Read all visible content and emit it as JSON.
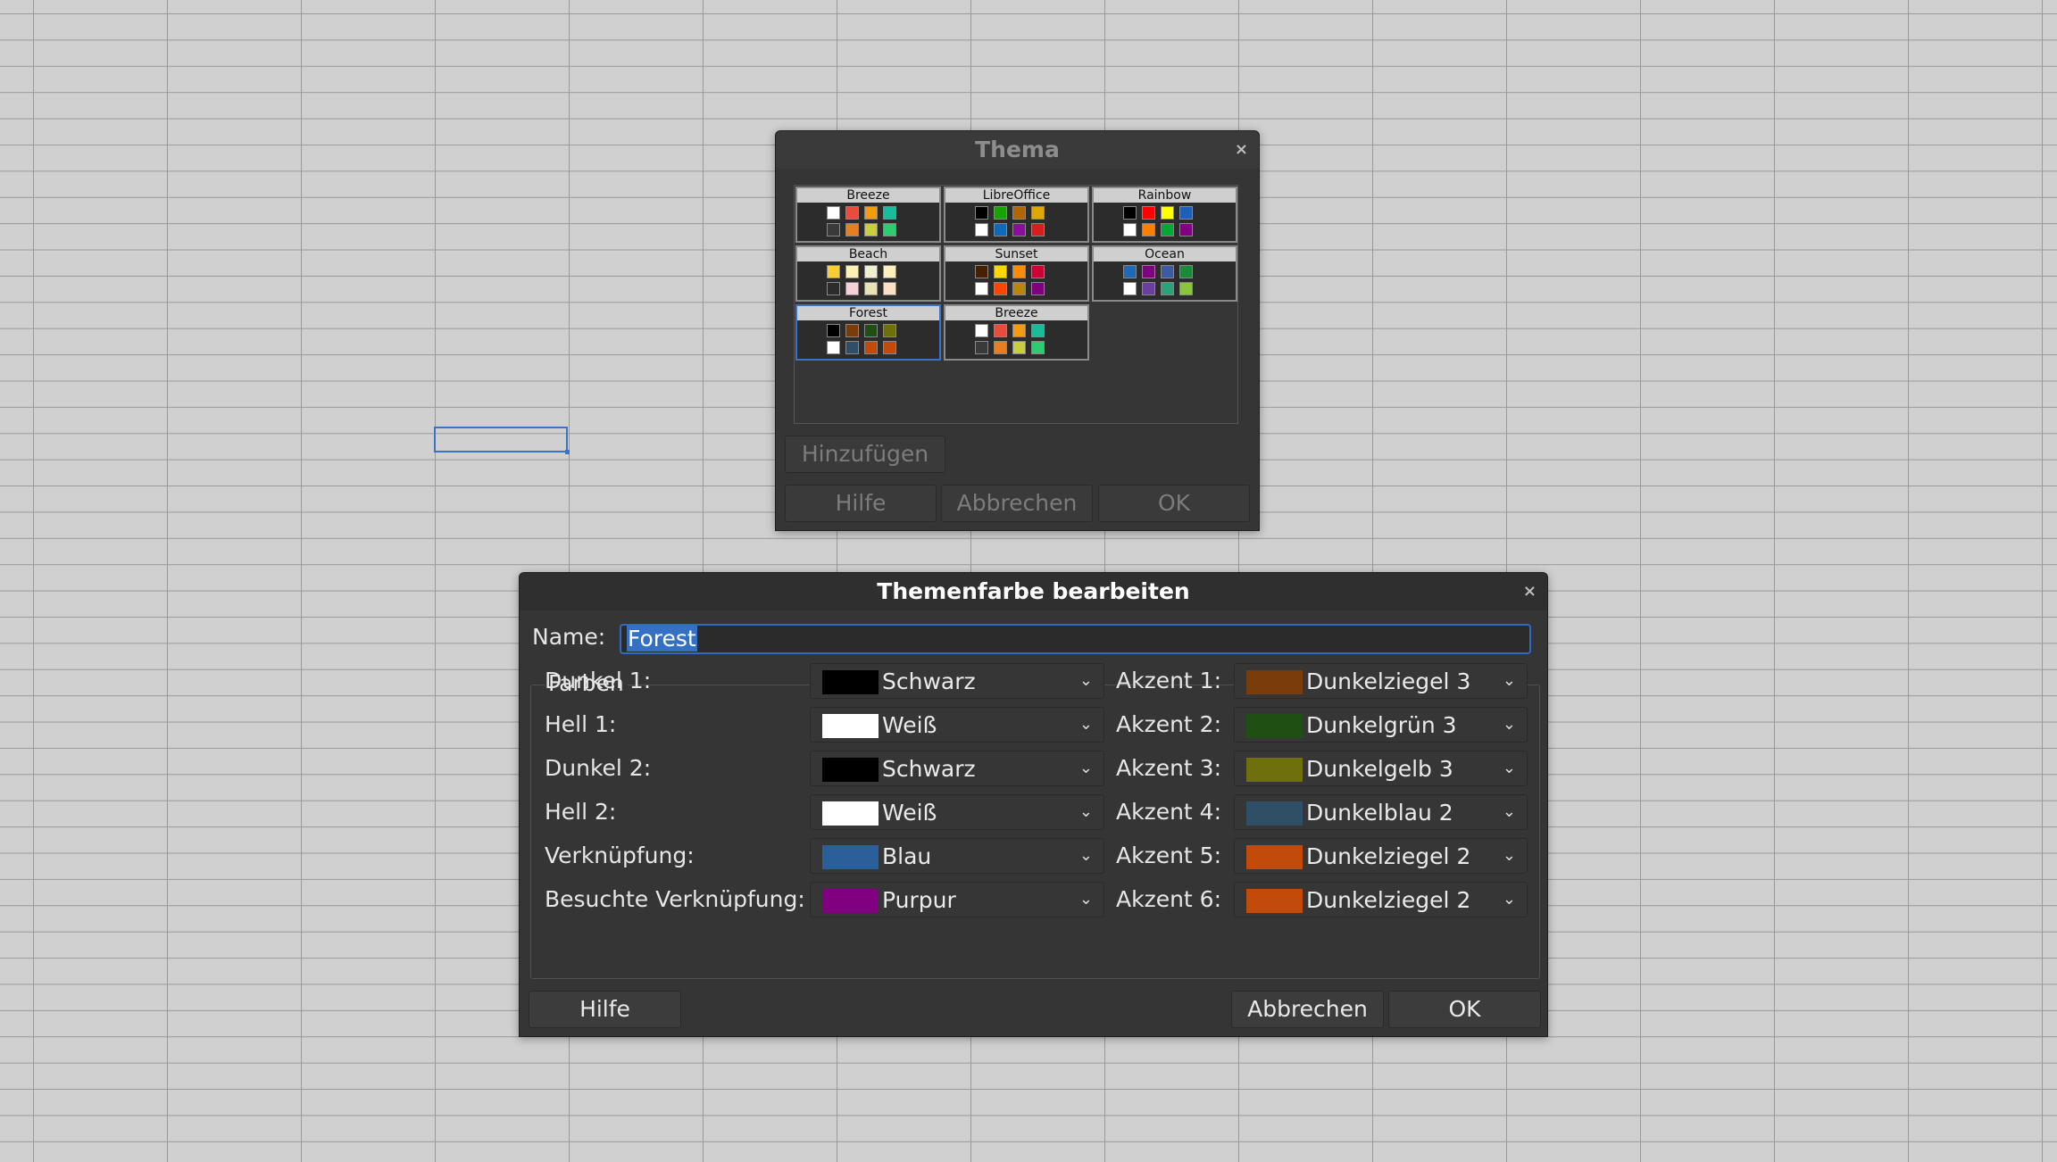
{
  "theme_dialog": {
    "title": "Thema",
    "close_icon": "close-icon",
    "themes": [
      {
        "name": "Breeze",
        "colors": [
          "#ffffff",
          "#3a3a3a",
          "#ffffff",
          "#ffffff",
          "#e74c3c",
          "#f39c12",
          "#1abc9c",
          "#e67e22",
          "#c9ce3b",
          "#2ecc71"
        ]
      },
      {
        "name": "LibreOffice",
        "colors": [
          "#000000",
          "#ffffff",
          "#000000",
          "#ffffff",
          "#18a303",
          "#b36404",
          "#e0a70b",
          "#106ab8",
          "#8e0da0",
          "#d61e1e"
        ]
      },
      {
        "name": "Rainbow",
        "colors": [
          "#000000",
          "#ffffff",
          "#000000",
          "#ffffff",
          "#ff0000",
          "#ffff00",
          "#1e5fb8",
          "#ff8000",
          "#00a933",
          "#800080"
        ]
      },
      {
        "name": "Beach",
        "colors": [
          "#ffcc33",
          "#2c2c2c",
          "#fffbdb",
          "#fffbdb",
          "#fff0b3",
          "#f0f0d0",
          "#ffefbf",
          "#f6d0d8",
          "#e8e3b3",
          "#fce0c4"
        ]
      },
      {
        "name": "Sunset",
        "colors": [
          "#4b1e00",
          "#ffffff",
          "#4b1e00",
          "#fff5ce",
          "#ffd700",
          "#ff8c00",
          "#cc0033",
          "#ff4500",
          "#b8860b",
          "#800080"
        ]
      },
      {
        "name": "Ocean",
        "colors": [
          "#1e6ab8",
          "#ffffff",
          "#1e3a5f",
          "#e6f0ff",
          "#800080",
          "#3b5ba8",
          "#1c8a3a",
          "#6a3fa0",
          "#2aa37a",
          "#8ac33e"
        ]
      },
      {
        "name": "Forest",
        "colors": [
          "#000000",
          "#ffffff",
          "#000000",
          "#ffffff",
          "#7b3c0b",
          "#1f4f12",
          "#6f6f0e",
          "#2f4f66",
          "#c24a0a",
          "#c24a0a"
        ]
      },
      {
        "name": "Breeze",
        "colors": [
          "#ffffff",
          "#3a3a3a",
          "#ffffff",
          "#ffffff",
          "#e74c3c",
          "#f39c12",
          "#1abc9c",
          "#e67e22",
          "#c9ce3b",
          "#2ecc71"
        ]
      }
    ],
    "selected_index": 6,
    "add_button": "Hinzufügen",
    "help_button": "Hilfe",
    "cancel_button": "Abbrechen",
    "ok_button": "OK"
  },
  "edit_dialog": {
    "title": "Themenfarbe bearbeiten",
    "close_icon": "close-icon",
    "name_label": "Name:",
    "name_value": "Forest",
    "group_label": "Farben",
    "left_rows": [
      {
        "label": "Dunkel 1:",
        "value": "Schwarz",
        "color": "#000000"
      },
      {
        "label": "Hell 1:",
        "value": "Weiß",
        "color": "#ffffff"
      },
      {
        "label": "Dunkel 2:",
        "value": "Schwarz",
        "color": "#000000"
      },
      {
        "label": "Hell 2:",
        "value": "Weiß",
        "color": "#ffffff"
      },
      {
        "label": "Verknüpfung:",
        "value": "Blau",
        "color": "#2a6099"
      },
      {
        "label": "Besuchte Verknüpfung:",
        "value": "Purpur",
        "color": "#800080"
      }
    ],
    "right_rows": [
      {
        "label": "Akzent 1:",
        "value": "Dunkelziegel 3",
        "color": "#7b3c0b"
      },
      {
        "label": "Akzent 2:",
        "value": "Dunkelgrün 3",
        "color": "#1f4f12"
      },
      {
        "label": "Akzent 3:",
        "value": "Dunkelgelb 3",
        "color": "#6f6f0e"
      },
      {
        "label": "Akzent 4:",
        "value": "Dunkelblau 2",
        "color": "#2f4f66"
      },
      {
        "label": "Akzent 5:",
        "value": "Dunkelziegel 2",
        "color": "#c24a0a"
      },
      {
        "label": "Akzent 6:",
        "value": "Dunkelziegel 2",
        "color": "#c24a0a"
      }
    ],
    "help_button": "Hilfe",
    "cancel_button": "Abbrechen",
    "ok_button": "OK"
  },
  "icons": {
    "dropdown": "chevron-down-icon",
    "close": "close-icon"
  }
}
